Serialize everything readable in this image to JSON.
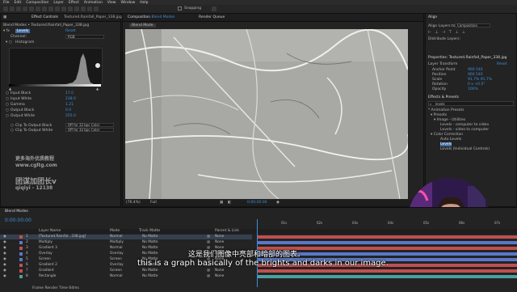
{
  "menu": [
    "File",
    "Edit",
    "Composition",
    "Layer",
    "Effect",
    "Animation",
    "View",
    "Window",
    "Help"
  ],
  "toolbar": {
    "snapping": "Snapping"
  },
  "left_panel": {
    "tab": "Effect Controls",
    "file": "Textured.Rainfall_Paper_338.jpg",
    "breadcrumb": "Blend Modes • Textured.Rainfall_Paper_338.jpg",
    "effect_name": "Levels",
    "reset": "Reset",
    "channel_label": "Channel:",
    "channel_value": "RGB",
    "histogram_label": "Histogram",
    "params": [
      {
        "label": "Input Black",
        "value": "17.0"
      },
      {
        "label": "Input White",
        "value": "238.0"
      },
      {
        "label": "Gamma",
        "value": "1.21"
      },
      {
        "label": "Output Black",
        "value": "0.0"
      },
      {
        "label": "Output White",
        "value": "255.0"
      }
    ],
    "clip_black": "Clip To Output Black",
    "clip_white": "Clip To Output White",
    "clip_value": "Off for 32 bpc Color"
  },
  "watermark": {
    "line1": "更多海外优质教程",
    "line2": "www.cgltg.com",
    "line3": "团谋加团长v",
    "line4": "qiqiyi - 12138"
  },
  "composition": {
    "tab": "Composition",
    "name": "Blend Modes",
    "render_queue": "Render Queue",
    "comp_tab": "Blend Mode",
    "zoom": "(76.4%)",
    "resolution": "Full",
    "timecode": "0:00:00:00"
  },
  "right_panel": {
    "align_tab": "Align",
    "align_to_label": "Align Layers to:",
    "align_to_value": "Composition",
    "distribute_label": "Distribute Layers:",
    "properties_title": "Properties: Textured.Rainfall_Paper_338.jpg",
    "layer_transform": "Layer Transform",
    "reset": "Reset",
    "props": [
      {
        "label": "Anchor Point",
        "value": "960  540"
      },
      {
        "label": "Position",
        "value": "960  540"
      },
      {
        "label": "Scale",
        "value": "91.7%  91.7%"
      },
      {
        "label": "Rotation",
        "value": "0 x +0.0°"
      },
      {
        "label": "Opacity",
        "value": "100%"
      }
    ],
    "effects_tab": "Effects & Presets",
    "search_value": "levels",
    "tree": [
      "* Animation Presets",
      "▾ Presets",
      "▾ Image - Utilities",
      "Levels - computer to video",
      "Levels - video to computer",
      "▾ Color Correction",
      "Auto Levels",
      "Levels",
      "Levels (Individual Controls)"
    ]
  },
  "timeline": {
    "tab": "Blend Modes",
    "timecode": "0:00:00:00",
    "col_layer": "Layer Name",
    "col_mode": "Mode",
    "col_trkmat": "Track Matte",
    "col_parent": "Parent & Link",
    "layers": [
      {
        "num": "1",
        "name": "[Textured.Rainfal...338.jpg]",
        "mode": "Normal",
        "matte": "No Matte",
        "parent": "None"
      },
      {
        "num": "2",
        "name": "Multiply",
        "mode": "Multiply",
        "matte": "No Matte",
        "parent": "None"
      },
      {
        "num": "3",
        "name": "Gradient 3",
        "mode": "Normal",
        "matte": "No Matte",
        "parent": "None"
      },
      {
        "num": "4",
        "name": "Overlay",
        "mode": "Overlay",
        "matte": "No Matte",
        "parent": "None"
      },
      {
        "num": "5",
        "name": "Screen",
        "mode": "Screen",
        "matte": "No Matte",
        "parent": "None"
      },
      {
        "num": "6",
        "name": "Gradient 2",
        "mode": "Overlay",
        "matte": "No Matte",
        "parent": "None"
      },
      {
        "num": "7",
        "name": "Gradient",
        "mode": "Screen",
        "matte": "No Matte",
        "parent": "None"
      },
      {
        "num": "8",
        "name": "Rectangle",
        "mode": "Normal",
        "matte": "No Matte",
        "parent": "None"
      }
    ],
    "ruler": [
      "01s",
      "02s",
      "03s",
      "04s",
      "05s",
      "06s",
      "07s"
    ],
    "footer": "Frame Render Time  64ms"
  },
  "subtitles": {
    "chinese": "这是我们图像中亮部和暗部的图表。",
    "english": "this is a graph basically of the brights and darks in our image."
  },
  "colors": {
    "accent_blue": "#3f8fd8",
    "track_red": "#c05050",
    "track_blue": "#5a78c8",
    "track_teal": "#4aa0a0",
    "neon_pink": "#ff4fb0"
  }
}
